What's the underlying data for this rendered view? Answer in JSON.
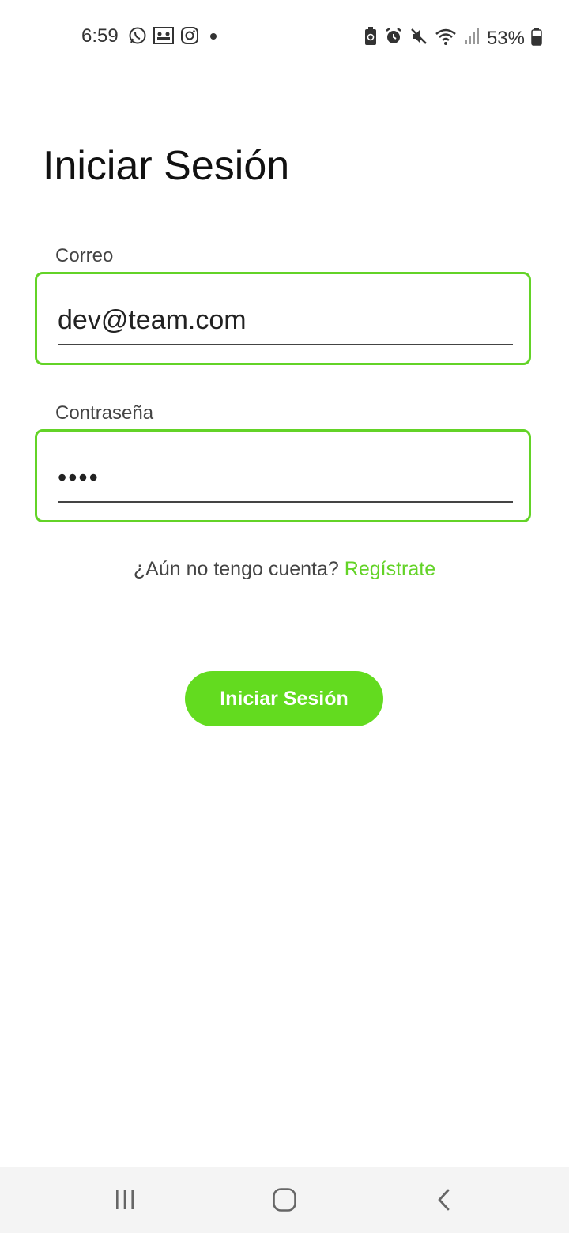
{
  "status_bar": {
    "time": "6:59",
    "battery_percent": "53%",
    "left_icons": [
      "whatsapp-icon",
      "gallery-icon",
      "instagram-icon",
      "dot-icon"
    ],
    "right_icons": [
      "battery-saver-icon",
      "alarm-icon",
      "mute-icon",
      "wifi-icon",
      "signal-icon",
      "battery-icon"
    ]
  },
  "page": {
    "title": "Iniciar Sesión"
  },
  "form": {
    "email_label": "Correo",
    "email_value": "dev@team.com",
    "password_label": "Contraseña",
    "password_value": "••••"
  },
  "register": {
    "prompt": "¿Aún no tengo cuenta?",
    "link": "Regístrate"
  },
  "login_button": {
    "label": "Iniciar Sesión"
  },
  "nav_bar": {
    "buttons": [
      "recent-apps-icon",
      "home-icon",
      "back-icon"
    ]
  },
  "colors": {
    "accent": "#63d327",
    "button": "#63db1f",
    "navbar_bg": "#f4f4f4"
  }
}
